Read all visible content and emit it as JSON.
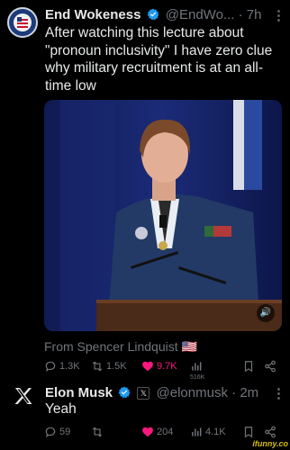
{
  "tweet1": {
    "author_name": "End Wokeness",
    "handle": "@EndWo...",
    "separator": "·",
    "time": "7h",
    "text": "After watching this lecture about \"pronoun inclusivity\" I have zero clue why military recruitment is at an all-time low",
    "attribution": "From Spencer Lindquist",
    "attribution_emoji": "🇺🇸",
    "actions": {
      "replies": "1.3K",
      "reposts": "1.5K",
      "likes": "9.7K",
      "views": "516K"
    }
  },
  "tweet2": {
    "author_name": "Elon Musk",
    "handle": "@elonmusk",
    "separator": "·",
    "time": "2m",
    "text": "Yeah",
    "actions": {
      "replies": "59",
      "reposts": "",
      "likes": "204",
      "views": "4.1K"
    }
  },
  "watermark": "ifunny.co",
  "colors": {
    "background": "#000000",
    "text": "#e7e9ea",
    "muted": "#71767b",
    "verified": "#1d9bf0",
    "like": "#f91880"
  },
  "icons": [
    "reply-icon",
    "repost-icon",
    "like-icon",
    "views-icon",
    "bookmark-icon",
    "share-icon",
    "verified-icon",
    "x-logo-icon",
    "more-icon",
    "sound-icon"
  ]
}
